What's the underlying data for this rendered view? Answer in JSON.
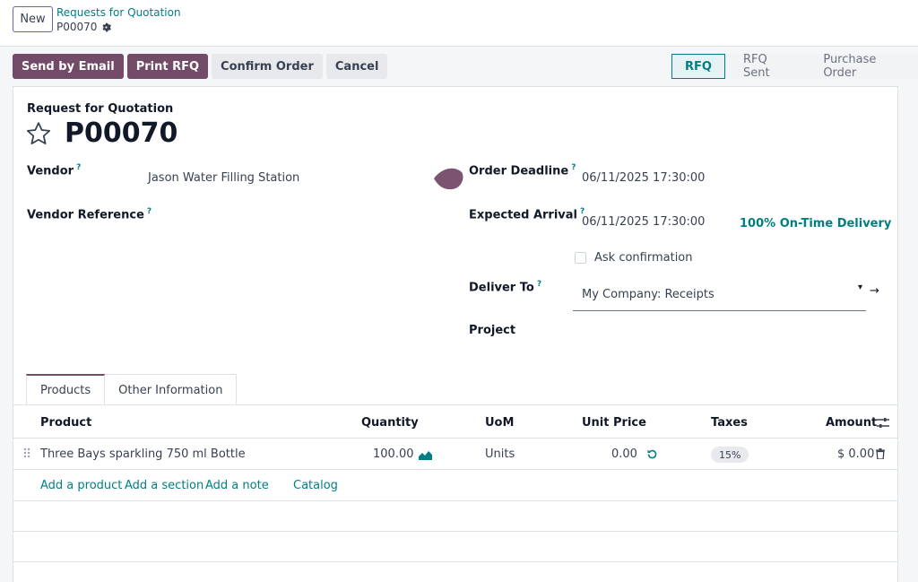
{
  "topbar": {
    "new_label": "New",
    "breadcrumb": "Requests for Quotation",
    "record_ref": "P00070"
  },
  "actions": {
    "send_email": "Send by Email",
    "print_rfq": "Print RFQ",
    "confirm": "Confirm Order",
    "cancel": "Cancel"
  },
  "status": {
    "stages": [
      "RFQ",
      "RFQ Sent",
      "Purchase Order"
    ],
    "active": "RFQ"
  },
  "form": {
    "doc_label": "Request for Quotation",
    "doc_name": "P00070",
    "vendor_label": "Vendor",
    "vendor_value": "Jason Water Filling Station",
    "vendor_ref_label": "Vendor Reference",
    "order_deadline_label": "Order Deadline",
    "order_deadline_value": "06/11/2025 17:30:00",
    "expected_arrival_label": "Expected Arrival",
    "expected_arrival_value": "06/11/2025 17:30:00",
    "on_time": "100% On-Time Delivery",
    "ask_confirmation": "Ask confirmation",
    "deliver_to_label": "Deliver To",
    "deliver_to_value": "My Company: Receipts",
    "project_label": "Project",
    "help_mark": "?"
  },
  "tabs": [
    "Products",
    "Other Information"
  ],
  "table": {
    "headers": {
      "product": "Product",
      "quantity": "Quantity",
      "uom": "UoM",
      "unit_price": "Unit Price",
      "taxes": "Taxes",
      "amount": "Amount"
    },
    "rows": [
      {
        "product": "Three Bays sparkling 750 ml Bottle",
        "quantity": "100.00",
        "uom": "Units",
        "unit_price": "0.00",
        "taxes": "15%",
        "amount": "$ 0.00"
      }
    ],
    "add_links": [
      "Add a product",
      "Add a section",
      "Add a note",
      "Catalog"
    ]
  },
  "colors": {
    "primary": "#714b67",
    "accent": "#017e84"
  }
}
